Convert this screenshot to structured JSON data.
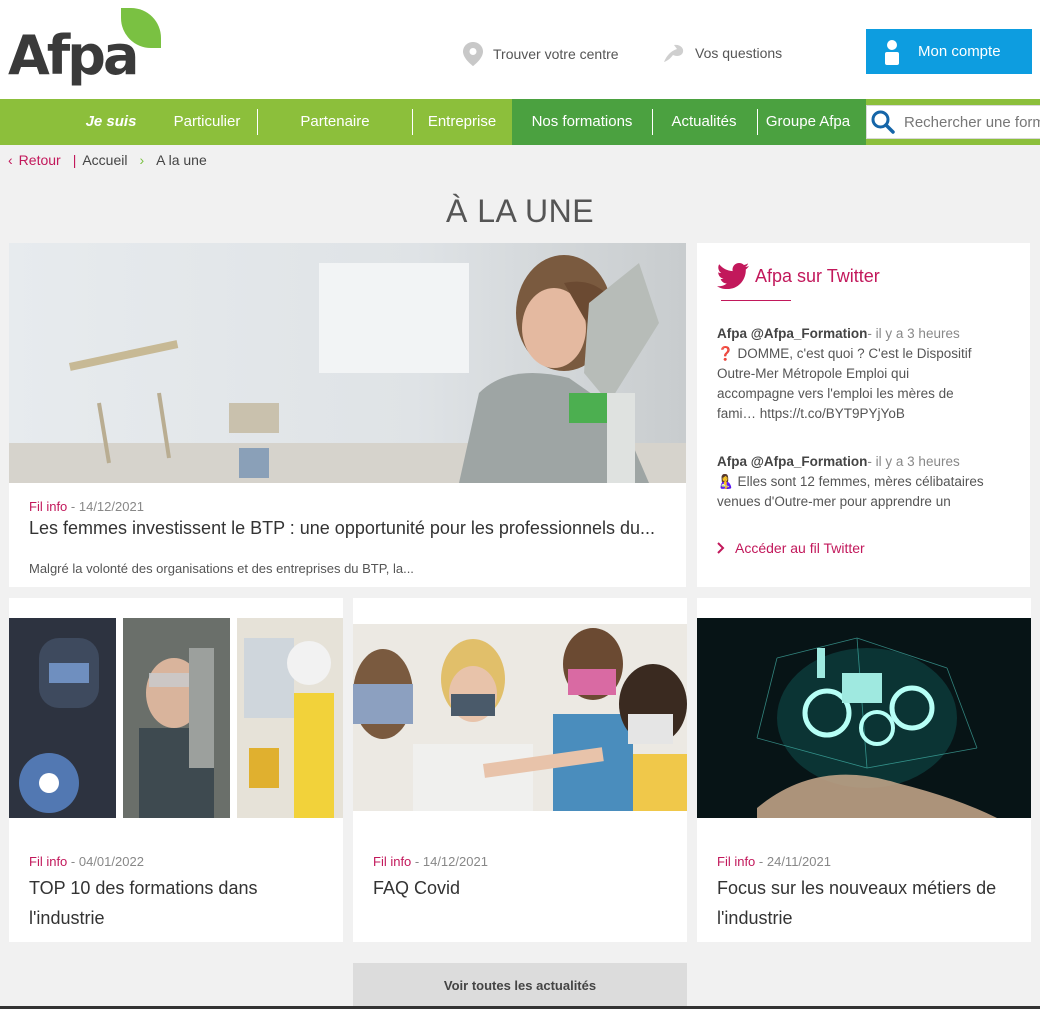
{
  "brand": {
    "logo_text": "Afpa",
    "accent": "#c2185b",
    "green": "#8cbf3b",
    "dark_green": "#4ba140",
    "blue": "#0d9de0"
  },
  "header": {
    "find_center": "Trouver votre centre",
    "find_center_icon": "location-pin-icon",
    "questions": "Vos questions",
    "questions_icon": "chat-bubble-icon",
    "account": "Mon compte",
    "account_icon": "user-icon"
  },
  "nav": {
    "je_suis": "Je suis",
    "items": [
      "Particulier",
      "Partenaire",
      "Entreprise",
      "Nos formations",
      "Actualités",
      "Groupe Afpa"
    ],
    "search_placeholder": "Rechercher une formation"
  },
  "breadcrumb": {
    "back": "Retour",
    "sep": "|",
    "home": "Accueil",
    "current": "A la une"
  },
  "page_title": "À LA UNE",
  "featured": {
    "category": "Fil info",
    "date": "- 14/12/2021",
    "title": "Les femmes investissent le BTP : une opportunité pour les professionnels du...",
    "excerpt": "Malgré la volonté des organisations et des entreprises du BTP, la..."
  },
  "twitter": {
    "heading": "Afpa sur Twitter",
    "tweets": [
      {
        "author": "Afpa @Afpa_Formation",
        "when": "- il y a 3 heures",
        "text": "❓ DOMME, c'est quoi ? C'est le Dispositif Outre-Mer Métropole Emploi qui accompagne vers l'emploi les mères de fami… https://t.co/BYT9PYjYoB"
      },
      {
        "author": "Afpa @Afpa_Formation",
        "when": "- il y a 3 heures",
        "text": "🤱 Elles sont 12 femmes, mères célibataires venues d'Outre-mer pour apprendre un"
      }
    ],
    "link": "Accéder au fil Twitter"
  },
  "cards": [
    {
      "category": "Fil info",
      "date": "- 04/01/2022",
      "title": "TOP 10 des formations dans l'industrie"
    },
    {
      "category": "Fil info",
      "date": "- 14/12/2021",
      "title": "FAQ Covid"
    },
    {
      "category": "Fil info",
      "date": "- 24/11/2021",
      "title": "Focus sur les nouveaux métiers de l'industrie"
    }
  ],
  "more_button": "Voir toutes les actualités"
}
